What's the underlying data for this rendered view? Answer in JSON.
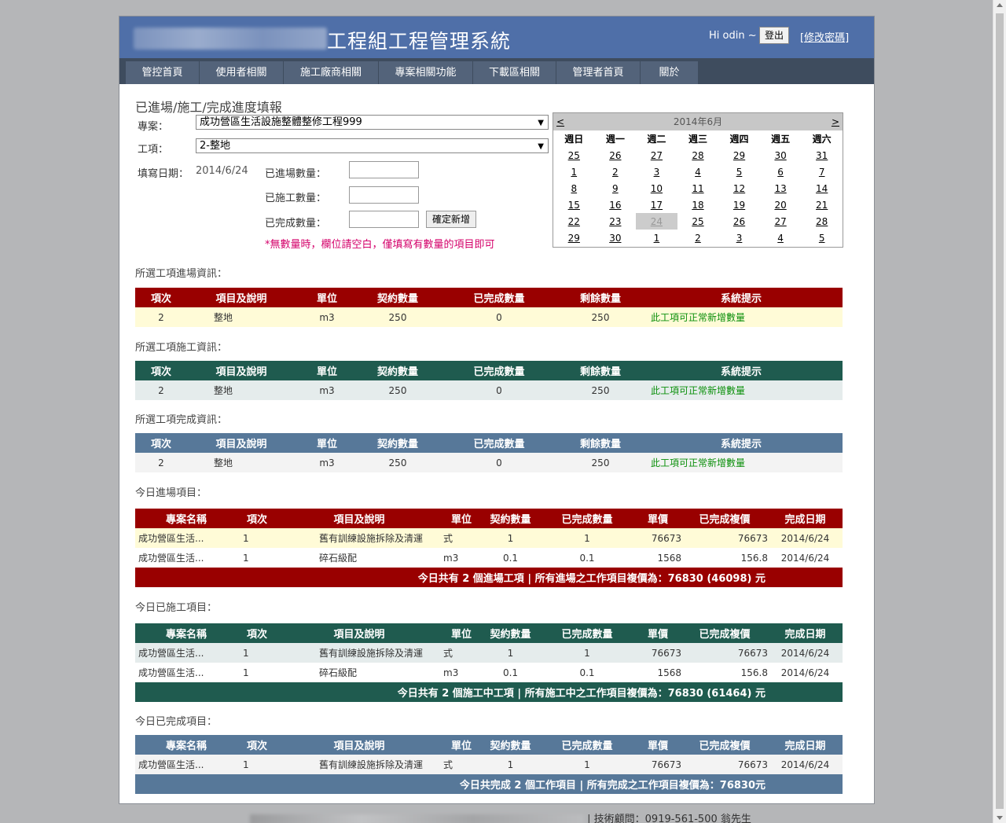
{
  "header": {
    "title": "工程組工程管理系統",
    "greeting": "Hi odin ~",
    "logout": "登出",
    "change_password": "[修改密碼]"
  },
  "nav": [
    "管控首頁",
    "使用者相關",
    "施工廠商相關",
    "專案相關功能",
    "下載區相關",
    "管理者首頁",
    "關於"
  ],
  "form": {
    "section_title": "已進場/施工/完成進度填報",
    "project_label": "專案：",
    "project_value": "成功營區生活設施整體整修工程999",
    "item_label": "工項：",
    "item_value": "2-整地",
    "date_label": "填寫日期：",
    "date_value": "2014/6/24",
    "arrived_label": "已進場數量：",
    "built_label": "已施工數量：",
    "completed_label": "已完成數量：",
    "add_button": "確定新增",
    "note": "*無數量時，欄位請空白，僅填寫有數量的項目即可"
  },
  "calendar": {
    "prev": "<",
    "next": ">",
    "month": "2014年6月",
    "weekdays": [
      "週日",
      "週一",
      "週二",
      "週三",
      "週四",
      "週五",
      "週六"
    ],
    "weeks": [
      [
        "25",
        "26",
        "27",
        "28",
        "29",
        "30",
        "31"
      ],
      [
        "1",
        "2",
        "3",
        "4",
        "5",
        "6",
        "7"
      ],
      [
        "8",
        "9",
        "10",
        "11",
        "12",
        "13",
        "14"
      ],
      [
        "15",
        "16",
        "17",
        "18",
        "19",
        "20",
        "21"
      ],
      [
        "22",
        "23",
        "24",
        "25",
        "26",
        "27",
        "28"
      ],
      [
        "29",
        "30",
        "1",
        "2",
        "3",
        "4",
        "5"
      ]
    ],
    "selected": "24"
  },
  "info_headers": [
    "項次",
    "項目及說明",
    "單位",
    "契約數量",
    "已完成數量",
    "剩餘數量",
    "系統提示"
  ],
  "arrive_info": {
    "title": "所選工項進場資訊：",
    "row": [
      "2",
      "整地",
      "m3",
      "250",
      "0",
      "250",
      "此工項可正常新增數量"
    ]
  },
  "build_info": {
    "title": "所選工項施工資訊：",
    "row": [
      "2",
      "整地",
      "m3",
      "250",
      "0",
      "250",
      "此工項可正常新增數量"
    ]
  },
  "complete_info": {
    "title": "所選工項完成資訊：",
    "row": [
      "2",
      "整地",
      "m3",
      "250",
      "0",
      "250",
      "此工項可正常新增數量"
    ]
  },
  "today_headers": [
    "專案名稱",
    "項次",
    "項目及說明",
    "單位",
    "契約數量",
    "已完成數量",
    "單價",
    "已完成複價",
    "完成日期"
  ],
  "today_arrive": {
    "title": "今日進場項目：",
    "rows": [
      [
        "成功營區生活...",
        "1",
        "舊有訓練設施拆除及清運",
        "式",
        "1",
        "1",
        "76673",
        "76673",
        "2014/6/24"
      ],
      [
        "成功營區生活...",
        "1",
        "碎石級配",
        "m3",
        "0.1",
        "0.1",
        "1568",
        "156.8",
        "2014/6/24"
      ]
    ],
    "summary": "今日共有 2 個進場工項 | 所有進場之工作項目複價為：76830 (46098) 元"
  },
  "today_build": {
    "title": "今日已施工項目：",
    "rows": [
      [
        "成功營區生活...",
        "1",
        "舊有訓練設施拆除及清運",
        "式",
        "1",
        "1",
        "76673",
        "76673",
        "2014/6/24"
      ],
      [
        "成功營區生活...",
        "1",
        "碎石級配",
        "m3",
        "0.1",
        "0.1",
        "1568",
        "156.8",
        "2014/6/24"
      ]
    ],
    "summary": "今日共有 2 個施工中工項 | 所有施工中之工作項目複價為：76830 (61464) 元"
  },
  "today_complete": {
    "title": "今日已完成項目：",
    "rows": [
      [
        "成功營區生活...",
        "1",
        "舊有訓練設施拆除及清運",
        "式",
        "1",
        "1",
        "76673",
        "76673",
        "2014/6/24"
      ]
    ],
    "summary": "今日共完成 2 個工作項目 | 所有完成之工作項目複價為：76830元"
  },
  "footer": {
    "consultant": "| 技術顧問：0919-561-500 翁先生"
  }
}
